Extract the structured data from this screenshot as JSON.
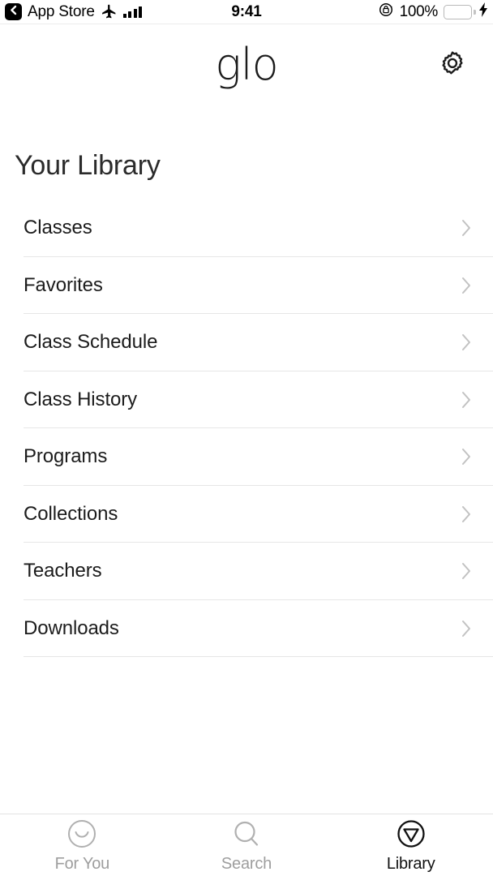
{
  "status_bar": {
    "back_label": "App Store",
    "back_icon": "chevron-left-icon",
    "airplane_icon": "airplane-mode-icon",
    "signal_icon": "cellular-signal-icon",
    "time": "9:41",
    "rotation_lock_icon": "rotation-lock-icon",
    "battery_percent": "100%",
    "battery_icon": "battery-full-icon",
    "charging_icon": "charging-bolt-icon",
    "battery_color": "#58e063"
  },
  "header": {
    "logo_text": "glo",
    "settings_icon": "gear-icon"
  },
  "page": {
    "title": "Your Library"
  },
  "list": {
    "chevron_icon": "chevron-right-icon",
    "items": [
      {
        "label": "Classes"
      },
      {
        "label": "Favorites"
      },
      {
        "label": "Class Schedule"
      },
      {
        "label": "Class History"
      },
      {
        "label": "Programs"
      },
      {
        "label": "Collections"
      },
      {
        "label": "Teachers"
      },
      {
        "label": "Downloads"
      }
    ]
  },
  "tab_bar": {
    "active_color": "#111111",
    "inactive_color": "#9e9e9e",
    "tabs": [
      {
        "label": "For You",
        "icon": "smiley-face-icon",
        "active": false
      },
      {
        "label": "Search",
        "icon": "magnifying-glass-icon",
        "active": false
      },
      {
        "label": "Library",
        "icon": "triangle-in-circle-icon",
        "active": true
      }
    ]
  }
}
